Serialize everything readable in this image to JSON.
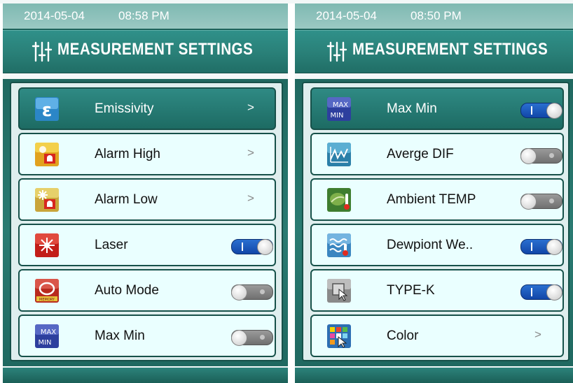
{
  "left": {
    "status": {
      "date": "2014-05-04",
      "time": "08:58 PM"
    },
    "title": "MEASUREMENT SETTINGS",
    "items": [
      {
        "label": "Emissivity",
        "icon": "epsilon-icon",
        "chevron": ">",
        "selected": true
      },
      {
        "label": "Alarm High",
        "icon": "alarm-high-icon",
        "chevron": ">"
      },
      {
        "label": "Alarm Low",
        "icon": "alarm-low-icon",
        "chevron": ">"
      },
      {
        "label": "Laser",
        "icon": "laser-icon",
        "toggle": true
      },
      {
        "label": "Auto Mode",
        "icon": "auto-mode-icon",
        "toggle": false
      },
      {
        "label": "Max  Min",
        "icon": "max-min-icon",
        "toggle": false
      }
    ],
    "icon_text": {
      "auto_mode": "MEMORY",
      "max_top": "MAX",
      "max_bottom": "MIN"
    }
  },
  "right": {
    "status": {
      "date": "2014-05-04",
      "time": "08:50 PM"
    },
    "title": "MEASUREMENT SETTINGS",
    "items": [
      {
        "label": "Max  Min",
        "icon": "max-min-icon",
        "toggle": true,
        "selected": true
      },
      {
        "label": "Averge DIF",
        "icon": "average-dif-icon",
        "toggle": false
      },
      {
        "label": "Ambient TEMP",
        "icon": "ambient-temp-icon",
        "toggle": false
      },
      {
        "label": "Dewpiont We..",
        "icon": "dewpoint-icon",
        "toggle": true
      },
      {
        "label": "TYPE-K",
        "icon": "type-k-icon",
        "toggle": true
      },
      {
        "label": "Color",
        "icon": "color-icon",
        "chevron": ">"
      }
    ],
    "icon_text": {
      "max_top": "MAX",
      "max_bottom": "MIN"
    }
  },
  "colors": {
    "panel": "#246f67",
    "title_bar": "#2a8179",
    "row_bg": "#eaffff",
    "selected_row": "#236f68",
    "toggle_on": "#1f5fc2",
    "toggle_off": "#8a8a8a"
  }
}
